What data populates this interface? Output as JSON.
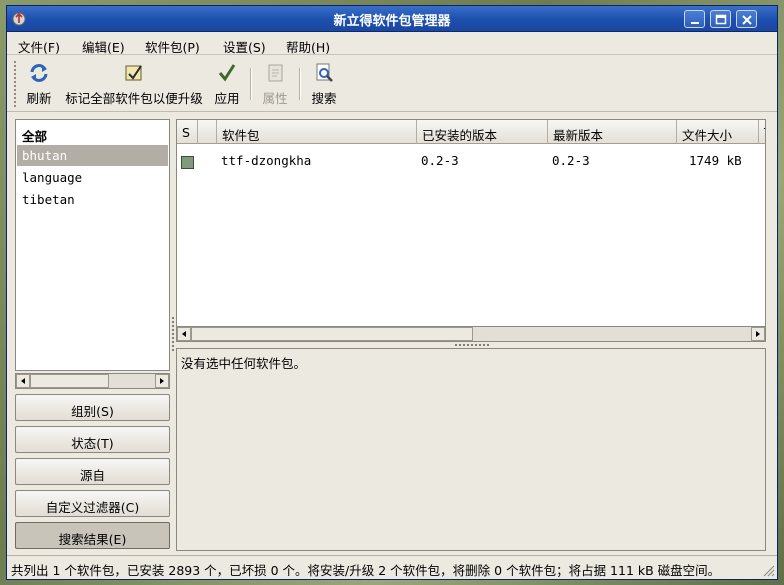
{
  "window": {
    "title": "新立得软件包管理器"
  },
  "menubar": {
    "file": "文件(F)",
    "edit": "编辑(E)",
    "package": "软件包(P)",
    "settings": "设置(S)",
    "help": "帮助(H)"
  },
  "toolbar": {
    "refresh": "刷新",
    "mark_all_upgrades": "标记全部软件包以便升级",
    "apply": "应用",
    "properties": "属性",
    "search": "搜索"
  },
  "sections": {
    "items": [
      {
        "label": "全部"
      },
      {
        "label": "bhutan"
      },
      {
        "label": "language"
      },
      {
        "label": "tibetan"
      }
    ],
    "selected": "bhutan"
  },
  "filter_buttons": {
    "sections": "组别(S)",
    "status": "状态(T)",
    "origin": "源自",
    "custom_filters": "自定义过滤器(C)",
    "search_results": "搜索结果(E)"
  },
  "package_table": {
    "columns": {
      "s": "S",
      "package": "软件包",
      "installed_version": "已安装的版本",
      "latest_version": "最新版本",
      "size": "文件大小",
      "extra": "T"
    },
    "rows": [
      {
        "name": "ttf-dzongkha",
        "installed_version": "0.2-3",
        "latest_version": "0.2-3",
        "size": "1749 kB"
      }
    ]
  },
  "description": {
    "text": "没有选中任何软件包。"
  },
  "statusbar": {
    "text": "共列出 1 个软件包，已安装 2893 个，已坏损 0 个。将安装/升级 2 个软件包，将删除 0 个软件包；将占据 111 kB 磁盘空间。"
  },
  "colors": {
    "titlebar": "#1d4fae",
    "window_bg": "#ece9e1",
    "selection": "#b3aea5",
    "status_installed": "#7f9b7c"
  }
}
